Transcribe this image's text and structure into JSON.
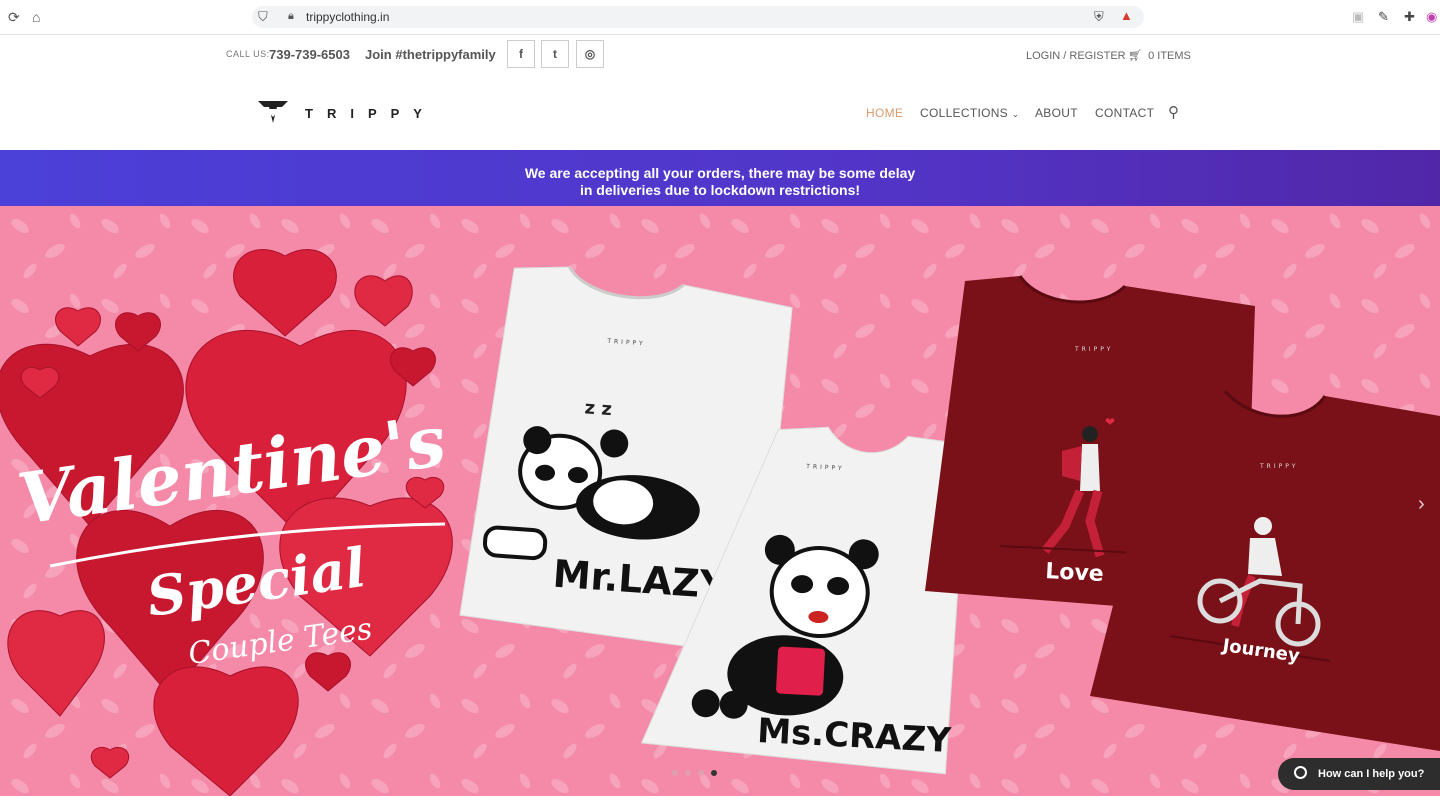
{
  "browser": {
    "url": "trippyclothing.in",
    "nav_icons": [
      "reload-icon",
      "home-icon"
    ],
    "extension_icons": [
      "brave-shield-icon",
      "brave-rewards-icon",
      "extension-icon",
      "puzzle-icon",
      "profile-icon"
    ]
  },
  "topbar": {
    "call_label": "CALL US:",
    "phone": "739-739-6503",
    "tagline": "Join #thetrippyfamily",
    "social": [
      {
        "icon": "facebook-icon",
        "glyph": "f"
      },
      {
        "icon": "twitter-icon",
        "glyph": "t"
      },
      {
        "icon": "instagram-icon",
        "glyph": "◎"
      }
    ],
    "login": "LOGIN / REGISTER",
    "cart": "0 ITEMS"
  },
  "header": {
    "logo_text": "TRIPPY",
    "menu": [
      {
        "label": "HOME",
        "active": true
      },
      {
        "label": "COLLECTIONS",
        "dropdown": true
      },
      {
        "label": "ABOUT"
      },
      {
        "label": "CONTACT"
      }
    ]
  },
  "notice": {
    "line1": "We are accepting all your orders, there may be some delay",
    "line2": "in deliveries due to lockdown restrictions!"
  },
  "hero": {
    "headline": "Valentine's",
    "headline2": "Special",
    "headline3": "Couple Tees",
    "shirt_white_1": "Mr.LAZY",
    "shirt_white_2": "Ms.CRAZY",
    "shirt_red_1": "Love",
    "shirt_red_2": "Journey",
    "brand_tag": "TRIPPY",
    "slide_count": 4,
    "active_slide": 3,
    "colors": {
      "background": "#f48aa8",
      "heart": "#d8203a",
      "shirt_red": "#7a1018",
      "shirt_white": "#f2f2f2"
    }
  },
  "chat": {
    "label": "How can I help you?"
  }
}
